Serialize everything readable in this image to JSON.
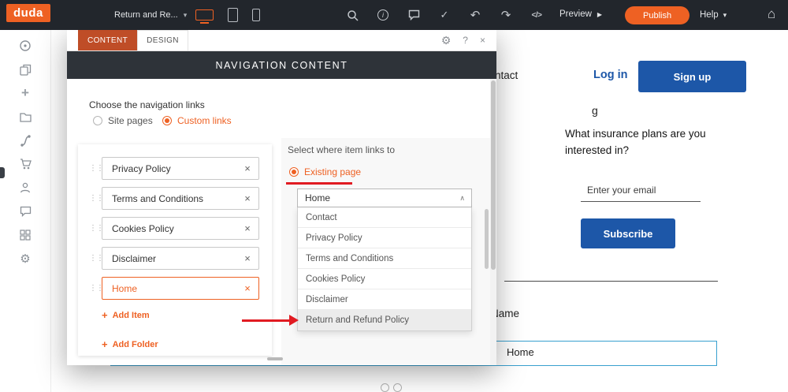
{
  "icons": {
    "chevron_down": "▾",
    "check": "✓",
    "undo": "↶",
    "redo": "↷",
    "code": "</>",
    "play": "▶",
    "home": "⌂",
    "gear": "⚙",
    "question": "?",
    "close": "×",
    "caret_up": "∧",
    "drag": "⋮⋮",
    "plus": "+",
    "info": "i"
  },
  "topbar": {
    "logo": "duda",
    "page_dropdown": "Return and Re...",
    "preview": "Preview",
    "publish": "Publish",
    "help": "Help"
  },
  "modal": {
    "tabs": [
      "CONTENT",
      "DESIGN"
    ],
    "title": "NAVIGATION CONTENT",
    "choose_label": "Choose the navigation links",
    "radio_site_pages": "Site pages",
    "radio_custom_links": "Custom links",
    "nav_items": [
      "Privacy Policy",
      "Terms and Conditions",
      "Cookies Policy",
      "Disclaimer",
      "Home"
    ],
    "active_item": "Home",
    "add_item": "Add Item",
    "add_folder": "Add Folder",
    "select_where": "Select where item links to",
    "radio_existing": "Existing page",
    "dropdown_value": "Home",
    "dropdown_options": [
      "Contact",
      "Privacy Policy",
      "Terms and Conditions",
      "Cookies Policy",
      "Disclaimer",
      "Return and Refund Policy"
    ],
    "highlighted_option": "Return and Refund Policy"
  },
  "page": {
    "contact_partial": "ntact",
    "partial_letter": "g",
    "login": "Log in",
    "signup": "Sign up",
    "question": "What insurance plans are you interested in?",
    "email_placeholder": "Enter your email",
    "subscribe": "Subscribe",
    "name_label": "Name",
    "menu_item": "Home"
  },
  "colors": {
    "accent_orange": "#ee6123",
    "primary_blue": "#1d57a8",
    "annotation_red": "#e11b22",
    "topbar_bg": "#22262c",
    "modal_header_bg": "#2e3339"
  }
}
